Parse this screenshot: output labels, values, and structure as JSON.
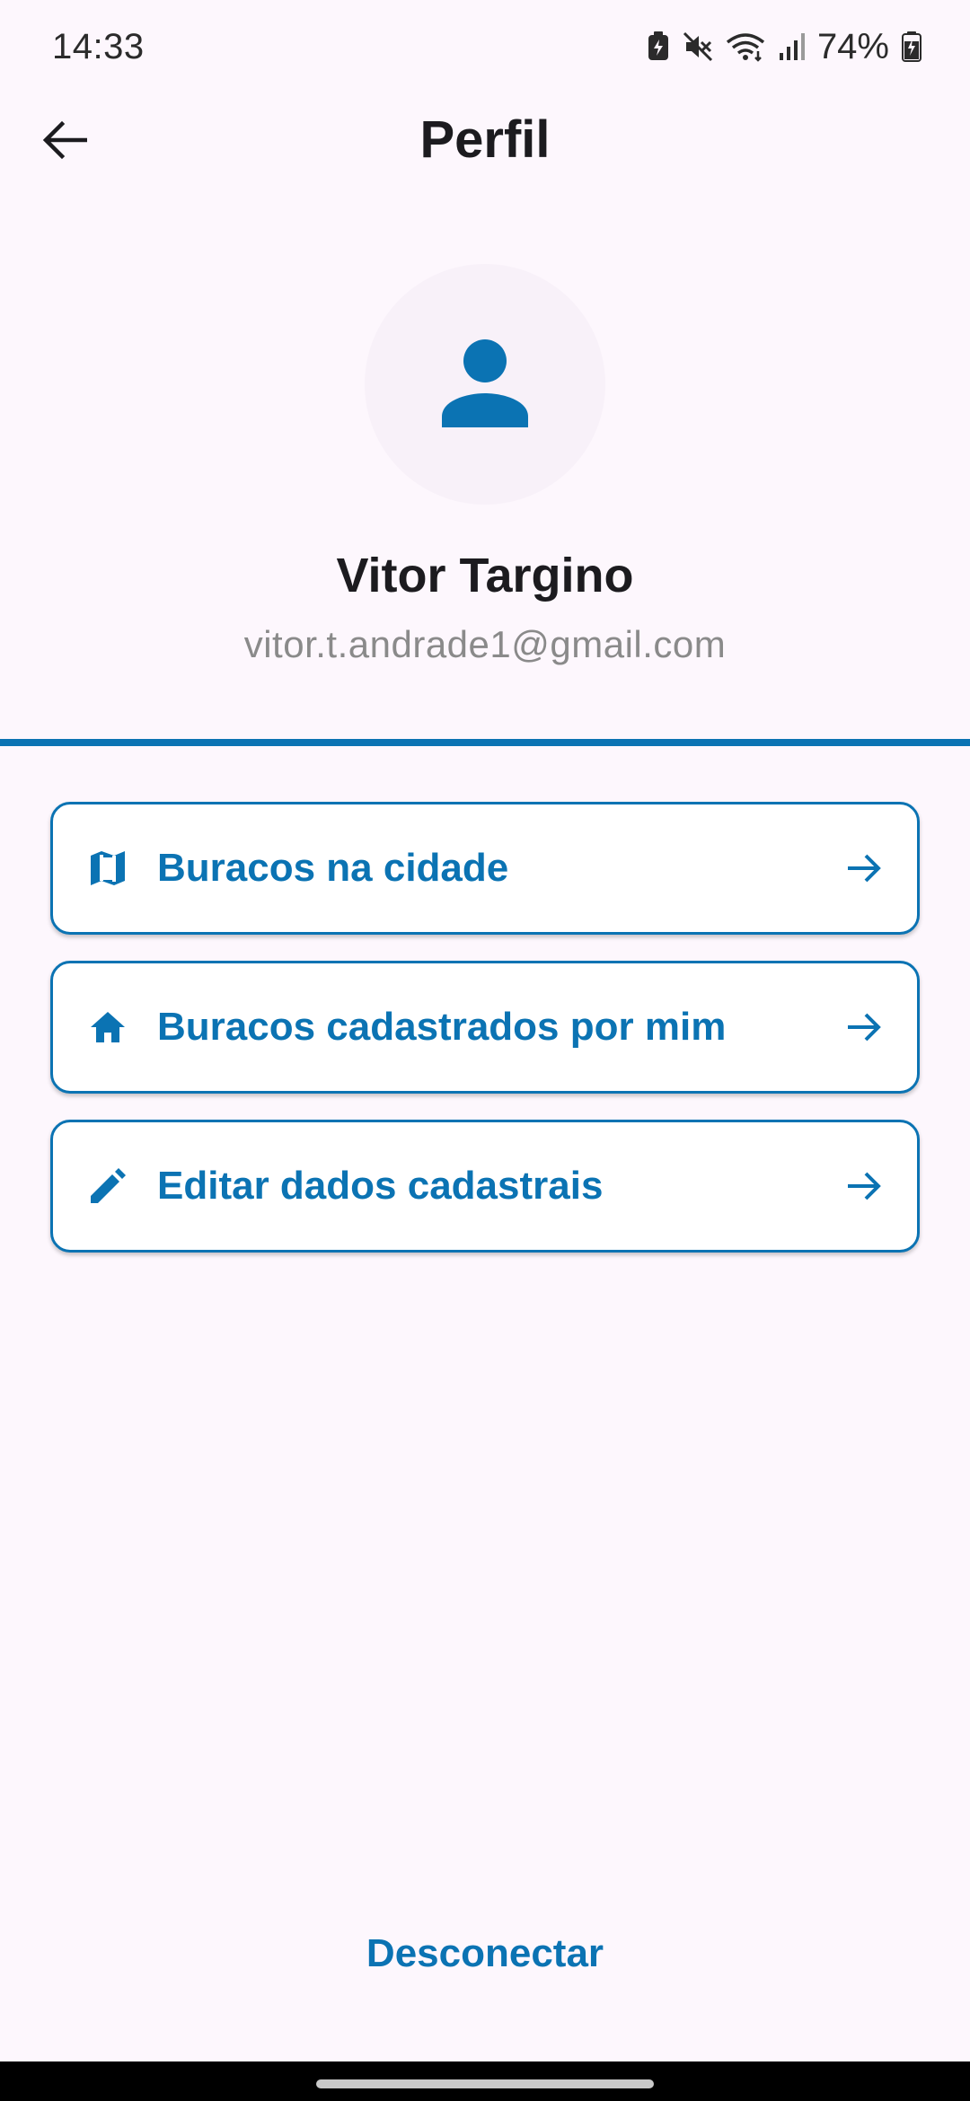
{
  "status_bar": {
    "time": "14:33",
    "battery": "74%",
    "icons": [
      "battery-saver-icon",
      "mute-icon",
      "wifi-icon",
      "signal-icon",
      "battery-icon"
    ]
  },
  "app_bar": {
    "title": "Perfil",
    "back_icon": "arrow-back-icon"
  },
  "profile": {
    "avatar_icon": "person-icon",
    "name": "Vitor Targino",
    "email": "vitor.t.andrade1@gmail.com"
  },
  "menu": {
    "items": [
      {
        "label": "Buracos na cidade",
        "icon": "map-icon"
      },
      {
        "label": "Buracos cadastrados por mim",
        "icon": "home-icon"
      },
      {
        "label": "Editar dados cadastrais",
        "icon": "edit-pencil-icon"
      }
    ],
    "trailing_icon": "arrow-forward-icon"
  },
  "logout": {
    "label": "Desconectar"
  },
  "colors": {
    "primary": "#0b73b3",
    "background": "#fdf7fd",
    "card": "#ffffff",
    "email_text": "#8a8a8a"
  }
}
